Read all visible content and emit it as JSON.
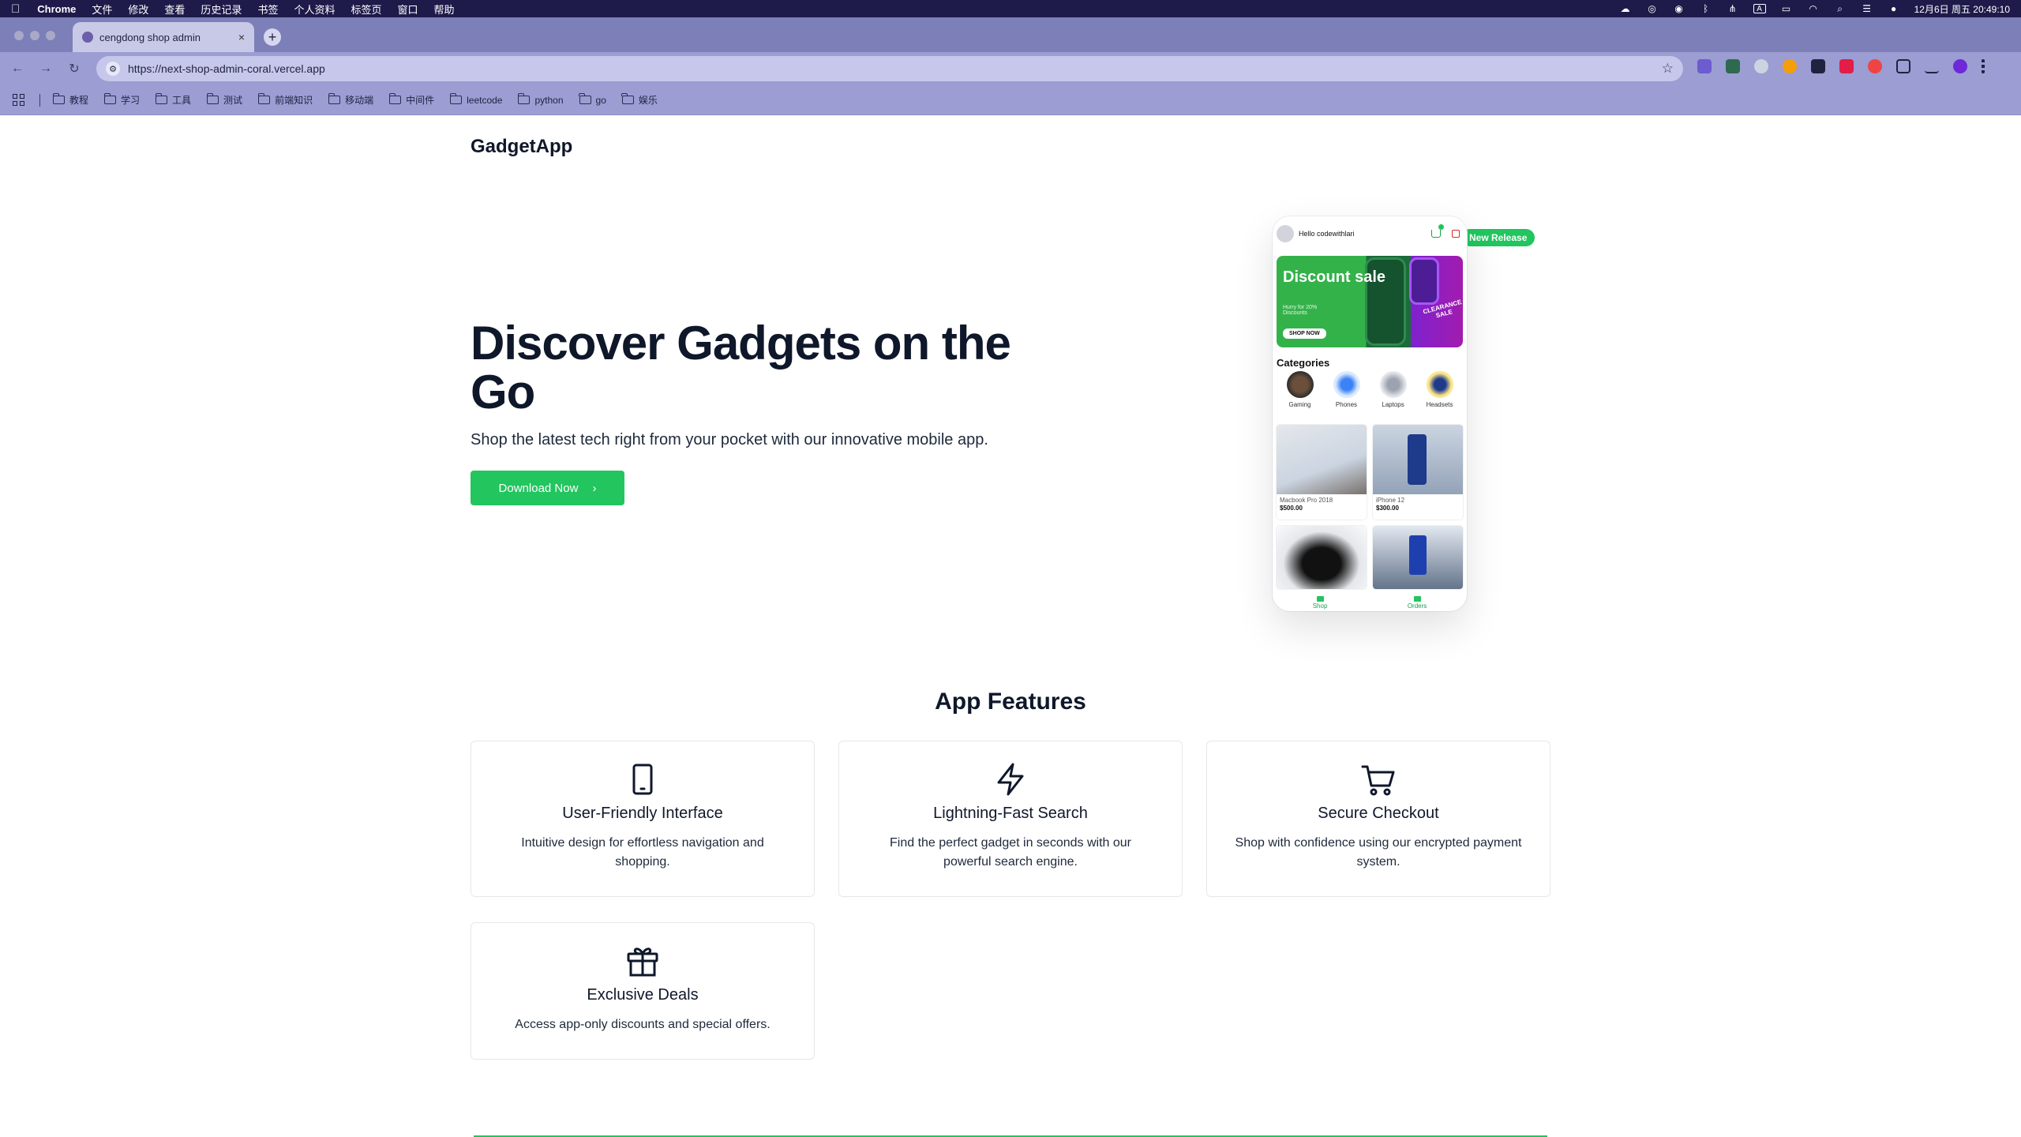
{
  "menubar": {
    "app": "Chrome",
    "items": [
      "文件",
      "修改",
      "查看",
      "历史记录",
      "书签",
      "个人资料",
      "标签页",
      "窗口",
      "帮助"
    ],
    "clock": "12月6日 周五 20:49:10",
    "input_indicator": "A"
  },
  "browser": {
    "tab_title": "cengdong shop admin",
    "url": "https://next-shop-admin-coral.vercel.app",
    "bookmarks": [
      "教程",
      "学习",
      "工具",
      "测试",
      "前端知识",
      "移动端",
      "中间件",
      "leetcode",
      "python",
      "go",
      "娱乐"
    ]
  },
  "page": {
    "brand": "GadgetApp",
    "hero": {
      "title": "Discover Gadgets on the Go",
      "subtitle": "Shop the latest tech right from your pocket with our innovative mobile app.",
      "cta": "Download Now",
      "badge": "New Release"
    },
    "phone": {
      "greeting": "Hello codewithlari",
      "banner_title": "Discount sale",
      "banner_sub": "Hurry for 20% Discounts",
      "banner_button": "SHOP NOW",
      "banner_tag": "CLEARANCE SALE",
      "categories_title": "Categories",
      "categories": [
        "Gaming",
        "Phones",
        "Laptops",
        "Headsets"
      ],
      "products": [
        {
          "name": "Macbook Pro 2018",
          "price": "$500.00"
        },
        {
          "name": "iPhone 12",
          "price": "$300.00"
        }
      ],
      "nav": [
        "Shop",
        "Orders"
      ]
    },
    "features_title": "App Features",
    "features": [
      {
        "icon": "tablet-icon",
        "title": "User-Friendly Interface",
        "desc": "Intuitive design for effortless navigation and shopping."
      },
      {
        "icon": "lightning-icon",
        "title": "Lightning-Fast Search",
        "desc": "Find the perfect gadget in seconds with our powerful search engine."
      },
      {
        "icon": "cart-icon",
        "title": "Secure Checkout",
        "desc": "Shop with confidence using our encrypted payment system."
      },
      {
        "icon": "gift-icon",
        "title": "Exclusive Deals",
        "desc": "Access app-only discounts and special offers."
      }
    ]
  },
  "colors": {
    "accent": "#22c55e",
    "menubar": "#1e1b4b",
    "browser_chrome": "#9b9dd3"
  }
}
